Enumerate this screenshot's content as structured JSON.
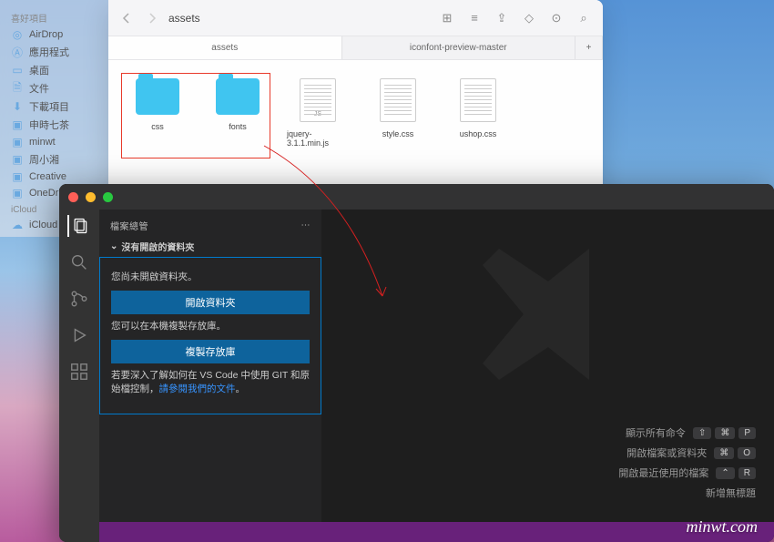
{
  "finder": {
    "sidebar": {
      "section_favorites": "喜好項目",
      "items": [
        "AirDrop",
        "應用程式",
        "桌面",
        "文件",
        "下載項目",
        "申時七茶",
        "minwt",
        "周小湘",
        "Creative",
        "OneDri"
      ],
      "section_icloud": "iCloud",
      "icloud_items": [
        "iCloud"
      ]
    },
    "toolbar": {
      "path_title": "assets"
    },
    "tabs": {
      "tab1": "assets",
      "tab2": "iconfont-preview-master",
      "plus": "+"
    },
    "files": [
      {
        "name": "css",
        "type": "folder"
      },
      {
        "name": "fonts",
        "type": "folder"
      },
      {
        "name": "jquery-3.1.1.min.js",
        "type": "js"
      },
      {
        "name": "style.css",
        "type": "doc"
      },
      {
        "name": "ushop.css",
        "type": "doc"
      }
    ]
  },
  "vscode": {
    "panel_title": "檔案總管",
    "sub_title": "沒有開啟的資料夾",
    "msg1": "您尚未開啟資料夾。",
    "btn_open": "開啟資料夾",
    "msg2": "您可以在本機複製存放庫。",
    "btn_clone": "複製存放庫",
    "msg3_a": "若要深入了解如何在 VS Code 中使用 GIT 和原始檔控制，",
    "msg3_link": "請參閱我們的文件",
    "msg3_b": "。",
    "shortcuts": [
      {
        "label": "顯示所有命令",
        "keys": [
          "⇧",
          "⌘",
          "P"
        ]
      },
      {
        "label": "開啟檔案或資料夾",
        "keys": [
          "⌘",
          "O"
        ]
      },
      {
        "label": "開啟最近使用的檔案",
        "keys": [
          "⌃",
          "R"
        ]
      },
      {
        "label": "新增無標題",
        "keys": []
      }
    ]
  },
  "watermark": "minwt.com"
}
